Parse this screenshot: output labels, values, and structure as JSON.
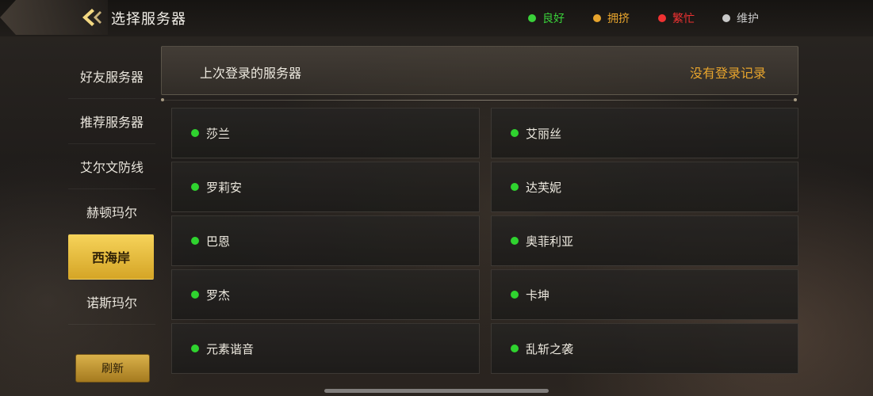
{
  "header": {
    "title": "选择服务器",
    "legend": [
      {
        "label": "良好",
        "color": "#3ad13a"
      },
      {
        "label": "拥挤",
        "color": "#e7a42d"
      },
      {
        "label": "繁忙",
        "color": "#f03232"
      },
      {
        "label": "维护",
        "color": "#c9c9c9"
      }
    ]
  },
  "sidebar": {
    "items": [
      {
        "label": "好友服务器"
      },
      {
        "label": "推荐服务器"
      },
      {
        "label": "艾尔文防线"
      },
      {
        "label": "赫顿玛尔"
      },
      {
        "label": "西海岸",
        "selected": true
      },
      {
        "label": "诺斯玛尔"
      }
    ],
    "refresh_label": "刷新"
  },
  "last_login": {
    "label": "上次登录的服务器",
    "record": "没有登录记录"
  },
  "servers": [
    {
      "name": "莎兰",
      "status": "良好"
    },
    {
      "name": "艾丽丝",
      "status": "良好"
    },
    {
      "name": "罗莉安",
      "status": "良好"
    },
    {
      "name": "达芙妮",
      "status": "良好"
    },
    {
      "name": "巴恩",
      "status": "良好"
    },
    {
      "name": "奥菲利亚",
      "status": "良好"
    },
    {
      "name": "罗杰",
      "status": "良好"
    },
    {
      "name": "卡坤",
      "status": "良好"
    },
    {
      "name": "元素谐音",
      "status": "良好"
    },
    {
      "name": "乱斩之袭",
      "status": "良好"
    }
  ],
  "colors": {
    "accent_gold": "#e7a42d",
    "status_good": "#2fd32f"
  }
}
